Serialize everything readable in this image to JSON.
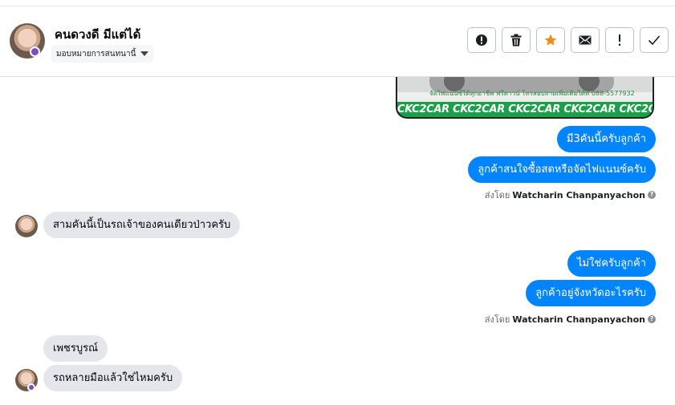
{
  "header": {
    "contact_name": "คนดวงดี มีแต่ได้",
    "assign_label": "มอบหมายการสนทนานี้",
    "actions": [
      {
        "name": "mark-spam-button",
        "icon": "alert-circle-icon"
      },
      {
        "name": "delete-button",
        "icon": "trash-icon"
      },
      {
        "name": "star-button",
        "icon": "star-icon"
      },
      {
        "name": "mark-unread-button",
        "icon": "envelope-icon"
      },
      {
        "name": "follow-up-button",
        "icon": "exclamation-icon"
      },
      {
        "name": "mark-done-button",
        "icon": "check-icon"
      }
    ]
  },
  "image_message": {
    "caption_small": "จัดไฟแนนซ์ได้ทุกอาชีพ ฟรีดาวน์ โทรสอบถามเพิ่มเติมได้ที่ 088-5577932",
    "banner": "CKC2CAR CKC2CAR CKC2CAR CKC2CAR CKC2CAR CKC2"
  },
  "messages": {
    "out1": "มี3คันนี้ครับลูกค้า",
    "out2": "ลูกค้าสนใจซื้อสดหรือจัดไฟแนนซ์ครับ",
    "sent_by_prefix": "ส่งโดย",
    "agent_name": "Watcharin Chanpanyachon",
    "in1": "สามคันนี้เป็นรถเจ้าของคนเดียวป่าวครับ",
    "out3": "ไม่ใช่ครับลูกค้า",
    "out4": "ลูกค้าอยู่จังหวัดอะไรครับ",
    "in2": "เพชรบูรณ์",
    "in3": "รถหลายมือแล้วใช่ไหมครับ"
  },
  "colors": {
    "outgoing_bubble": "#0084ff",
    "incoming_bubble": "#e4e6eb",
    "star_accent": "#f28a12"
  }
}
